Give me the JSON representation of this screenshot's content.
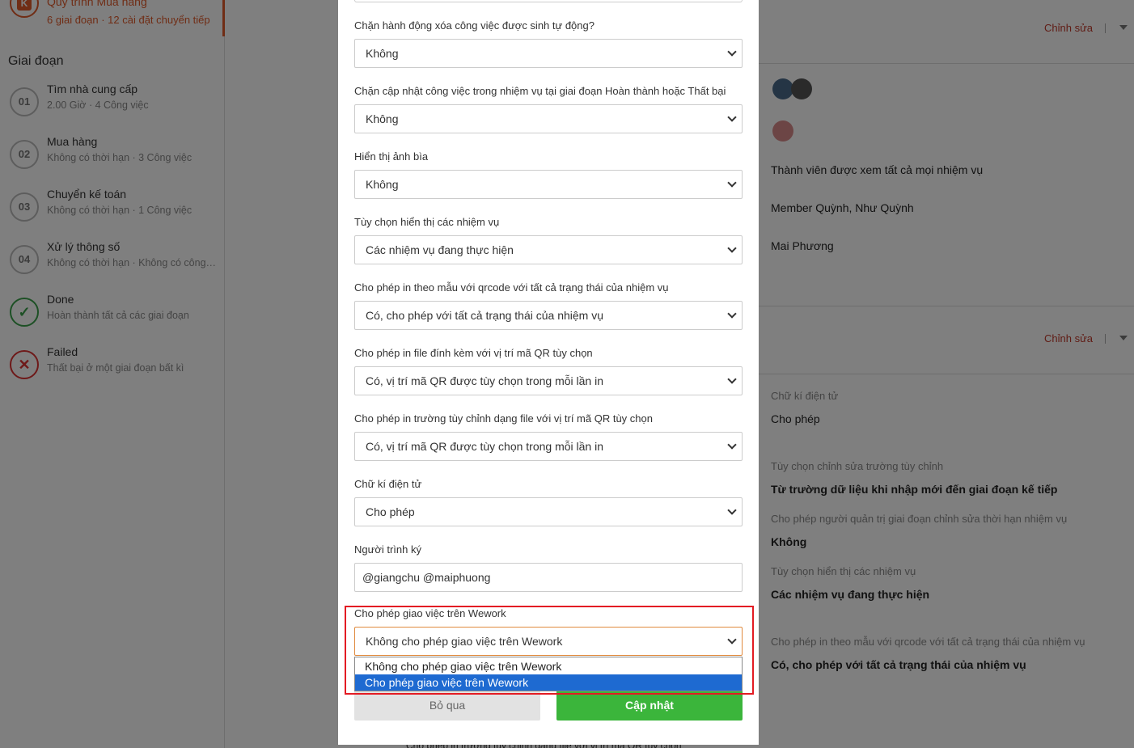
{
  "sidebar": {
    "process_title": "Quy trình Mua hàng",
    "process_sub": "6 giai đoạn · 12 cài đặt chuyển tiếp",
    "stages_header": "Giai đoạn",
    "stages": [
      {
        "num": "01",
        "name": "Tìm nhà cung cấp",
        "info": "2.00 Giờ · 4 Công việc"
      },
      {
        "num": "02",
        "name": "Mua hàng",
        "info": "Không có thời hạn · 3 Công việc"
      },
      {
        "num": "03",
        "name": "Chuyển kế toán",
        "info": "Không có thời hạn · 1 Công việc"
      },
      {
        "num": "04",
        "name": "Xử lý thông số",
        "info": "Không có thời hạn · Không có công việc"
      },
      {
        "num": "✓",
        "name": "Done",
        "info": "Hoàn thành tất cả các giai đoạn"
      },
      {
        "num": "✕",
        "name": "Failed",
        "info": "Thất bại ở một giai đoạn bất kì"
      }
    ]
  },
  "main": {
    "edit_label": "Chỉnh sửa",
    "members_all": "Thành viên được xem tất cả mọi nhiệm vụ",
    "members_list": "Member Quỳnh, Như Quỳnh",
    "member_single": "Mai Phương",
    "settings": [
      {
        "label": "Chữ kí điện tử",
        "value": "Cho phép"
      },
      {
        "label": "Tùy chọn chỉnh sửa trường tùy chỉnh",
        "value": "Từ trường dữ liệu khi nhập mới đến giai đoạn kế tiếp"
      },
      {
        "label": "Cho phép người quản trị giai đoạn chỉnh sửa thời hạn nhiệm vụ",
        "value": "Không"
      },
      {
        "label": "Tùy chọn hiển thị các nhiệm vụ",
        "value": "Các nhiệm vụ đang thực hiện"
      },
      {
        "label": "Cho phép in theo mẫu với qrcode với tất cả trạng thái của nhiệm vụ",
        "value": "Có, cho phép với tất cả trạng thái của nhiệm vụ"
      }
    ],
    "behind_text": "Cho phép in trường tùy chỉnh dạng file với vị trí mã QR tùy chọn"
  },
  "modal": {
    "fields": [
      {
        "label": "Chặn hành động xóa công việc được sinh tự động?",
        "value": "Không"
      },
      {
        "label": "Chặn cập nhật công việc trong nhiệm vụ tại giai đoạn Hoàn thành hoặc Thất bại",
        "value": "Không"
      },
      {
        "label": "Hiển thị ảnh bìa",
        "value": "Không"
      },
      {
        "label": "Tùy chọn hiển thị các nhiệm vụ",
        "value": "Các nhiệm vụ đang thực hiện"
      },
      {
        "label": "Cho phép in theo mẫu với qrcode với tất cả trạng thái của nhiệm vụ",
        "value": "Có, cho phép với tất cả trạng thái của nhiệm vụ"
      },
      {
        "label": "Cho phép in file đính kèm với vị trí mã QR tùy chọn",
        "value": "Có, vị trí mã QR được tùy chọn trong mỗi lần in"
      },
      {
        "label": "Cho phép in trường tùy chỉnh dạng file với vị trí mã QR tùy chọn",
        "value": "Có, vị trí mã QR được tùy chọn trong mỗi lần in"
      },
      {
        "label": "Chữ kí điện tử",
        "value": "Cho phép"
      }
    ],
    "signer_label": "Người trình ký",
    "signer_value": "@giangchu @maiphuong",
    "wework_label": "Cho phép giao việc trên Wework",
    "wework_value": "Không cho phép giao việc trên Wework",
    "wework_options": [
      "Không cho phép giao việc trên Wework",
      "Cho phép giao việc trên Wework"
    ],
    "cancel_label": "Bỏ qua",
    "update_label": "Cập nhật"
  },
  "colors": {
    "accent": "#e05a2b",
    "primary_button": "#3bb53b",
    "highlight": "#e31b23",
    "selected_option": "#1e6ad1"
  }
}
